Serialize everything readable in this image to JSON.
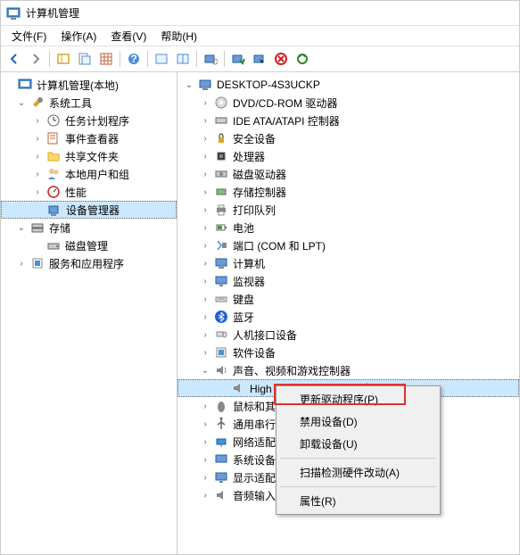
{
  "title": "计算机管理",
  "menu": {
    "file": "文件(F)",
    "action": "操作(A)",
    "view": "查看(V)",
    "help": "帮助(H)"
  },
  "left_tree": {
    "root": "计算机管理(本地)",
    "system_tools": "系统工具",
    "task_scheduler": "任务计划程序",
    "event_viewer": "事件查看器",
    "shared_folders": "共享文件夹",
    "local_users": "本地用户和组",
    "performance": "性能",
    "device_manager": "设备管理器",
    "storage": "存储",
    "disk_mgmt": "磁盘管理",
    "services": "服务和应用程序"
  },
  "right_tree": {
    "computer": "DESKTOP-4S3UCKP",
    "dvd": "DVD/CD-ROM 驱动器",
    "ide": "IDE ATA/ATAPI 控制器",
    "security": "安全设备",
    "processors": "处理器",
    "disk_drives": "磁盘驱动器",
    "storage_ctrl": "存储控制器",
    "print_queues": "打印队列",
    "batteries": "电池",
    "ports": "端口 (COM 和 LPT)",
    "computers": "计算机",
    "monitors": "监视器",
    "keyboards": "键盘",
    "bluetooth": "蓝牙",
    "hid": "人机接口设备",
    "software_dev": "软件设备",
    "sound": "声音、视频和游戏控制器",
    "audio_device": "High Definition Audio 设备",
    "mouse": "鼠标和其",
    "usb_serial": "通用串行",
    "network": "网络适配",
    "sys_dev": "系统设备",
    "display": "显示适配",
    "audio_in": "音频输入"
  },
  "context": {
    "update": "更新驱动程序(P)",
    "disable": "禁用设备(D)",
    "uninstall": "卸载设备(U)",
    "scan": "扫描检测硬件改动(A)",
    "properties": "属性(R)"
  }
}
